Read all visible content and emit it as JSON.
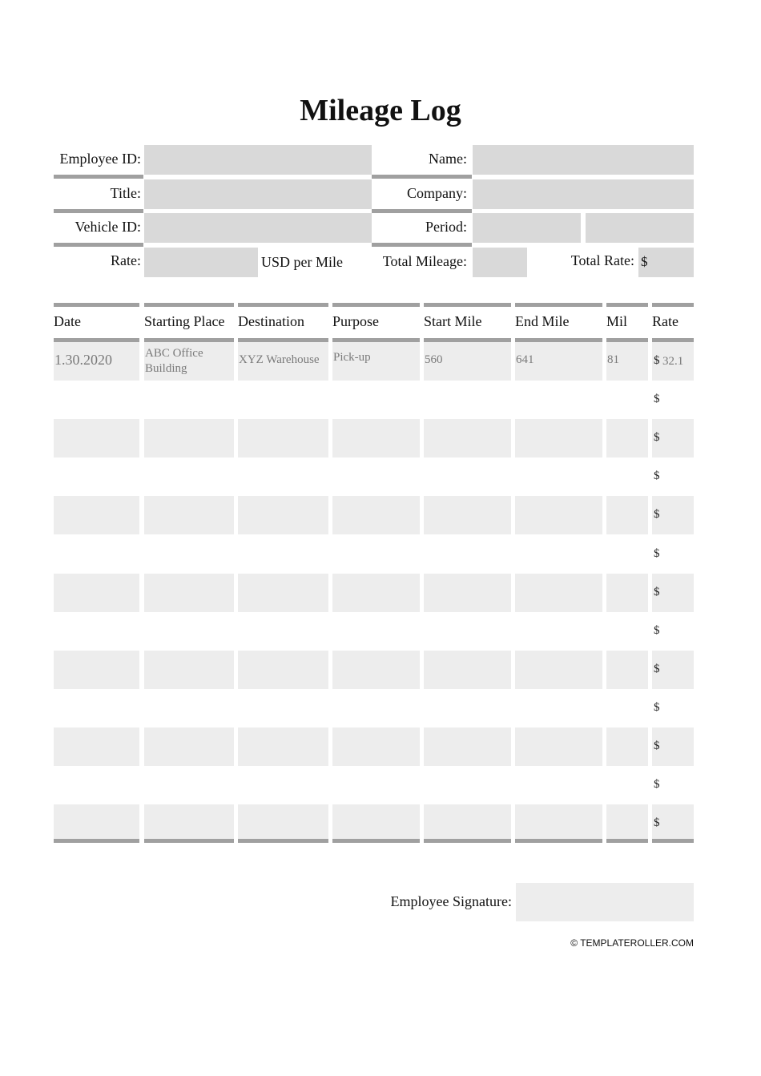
{
  "title": "Mileage Log",
  "header_fields": {
    "employee_id": {
      "label": "Employee ID:",
      "value": ""
    },
    "name": {
      "label": "Name:",
      "value": ""
    },
    "title": {
      "label": "Title:",
      "value": ""
    },
    "company": {
      "label": "Company:",
      "value": ""
    },
    "vehicle_id": {
      "label": "Vehicle ID:",
      "value": ""
    },
    "period": {
      "label": "Period:",
      "value_start": "",
      "value_end": ""
    },
    "rate": {
      "label": "Rate:",
      "value": "",
      "unit": "USD per Mile"
    },
    "total_mileage": {
      "label": "Total Mileage:",
      "value": ""
    },
    "total_rate": {
      "label": "Total Rate:",
      "currency": "$",
      "value": ""
    }
  },
  "table": {
    "columns": [
      "Date",
      "Starting Place",
      "Destination",
      "Purpose",
      "Start Mile",
      "End Mile",
      "Mil",
      "Rate"
    ],
    "currency": "$",
    "rows": [
      {
        "date": "1.30.2020",
        "starting_place": "ABC Office Building",
        "destination": "XYZ Warehouse",
        "purpose": "Pick-up",
        "start_mile": "560",
        "end_mile": "641",
        "miles": "81",
        "rate": "32.1"
      },
      {
        "date": "",
        "starting_place": "",
        "destination": "",
        "purpose": "",
        "start_mile": "",
        "end_mile": "",
        "miles": "",
        "rate": ""
      },
      {
        "date": "",
        "starting_place": "",
        "destination": "",
        "purpose": "",
        "start_mile": "",
        "end_mile": "",
        "miles": "",
        "rate": ""
      },
      {
        "date": "",
        "starting_place": "",
        "destination": "",
        "purpose": "",
        "start_mile": "",
        "end_mile": "",
        "miles": "",
        "rate": ""
      },
      {
        "date": "",
        "starting_place": "",
        "destination": "",
        "purpose": "",
        "start_mile": "",
        "end_mile": "",
        "miles": "",
        "rate": ""
      },
      {
        "date": "",
        "starting_place": "",
        "destination": "",
        "purpose": "",
        "start_mile": "",
        "end_mile": "",
        "miles": "",
        "rate": ""
      },
      {
        "date": "",
        "starting_place": "",
        "destination": "",
        "purpose": "",
        "start_mile": "",
        "end_mile": "",
        "miles": "",
        "rate": ""
      },
      {
        "date": "",
        "starting_place": "",
        "destination": "",
        "purpose": "",
        "start_mile": "",
        "end_mile": "",
        "miles": "",
        "rate": ""
      },
      {
        "date": "",
        "starting_place": "",
        "destination": "",
        "purpose": "",
        "start_mile": "",
        "end_mile": "",
        "miles": "",
        "rate": ""
      },
      {
        "date": "",
        "starting_place": "",
        "destination": "",
        "purpose": "",
        "start_mile": "",
        "end_mile": "",
        "miles": "",
        "rate": ""
      },
      {
        "date": "",
        "starting_place": "",
        "destination": "",
        "purpose": "",
        "start_mile": "",
        "end_mile": "",
        "miles": "",
        "rate": ""
      },
      {
        "date": "",
        "starting_place": "",
        "destination": "",
        "purpose": "",
        "start_mile": "",
        "end_mile": "",
        "miles": "",
        "rate": ""
      },
      {
        "date": "",
        "starting_place": "",
        "destination": "",
        "purpose": "",
        "start_mile": "",
        "end_mile": "",
        "miles": "",
        "rate": ""
      }
    ]
  },
  "signature": {
    "label": "Employee Signature:",
    "value": ""
  },
  "footer": {
    "copyright": "© TEMPLATEROLLER.COM"
  },
  "colors": {
    "field_fill": "#d9d9d9",
    "row_fill": "#ededed",
    "rule": "#a0a0a0",
    "entry_text": "#7a7a7a"
  }
}
